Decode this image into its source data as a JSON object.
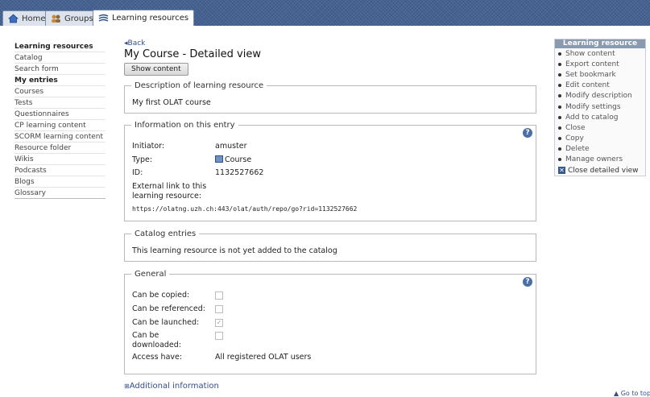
{
  "tabs": [
    {
      "label": "Home",
      "icon": "home-icon"
    },
    {
      "label": "Groups",
      "icon": "groups-icon"
    },
    {
      "label": "Learning resources",
      "icon": "learning-resources-icon",
      "active": true
    }
  ],
  "sidebar": {
    "items": [
      {
        "label": "Learning resources",
        "bold": true
      },
      {
        "label": "Catalog"
      },
      {
        "label": "Search form"
      },
      {
        "label": "My entries",
        "bold": true
      },
      {
        "label": "Courses"
      },
      {
        "label": "Tests"
      },
      {
        "label": "Questionnaires"
      },
      {
        "label": "CP learning content"
      },
      {
        "label": "SCORM learning content"
      },
      {
        "label": "Resource folder"
      },
      {
        "label": "Wikis"
      },
      {
        "label": "Podcasts"
      },
      {
        "label": "Blogs"
      },
      {
        "label": "Glossary"
      }
    ]
  },
  "main": {
    "back_label": "Back",
    "title": "My Course - Detailed view",
    "show_content_label": "Show content",
    "description": {
      "legend": "Description of learning resource",
      "text": "My first OLAT course"
    },
    "information": {
      "legend": "Information on this entry",
      "initiator_label": "Initiator:",
      "initiator_value": "amuster",
      "type_label": "Type:",
      "type_value": "Course",
      "id_label": "ID:",
      "id_value": "1132527662",
      "external_label": "External link to this learning resource:",
      "external_url": "https://olatng.uzh.ch:443/olat/auth/repo/go?rid=1132527662"
    },
    "catalog": {
      "legend": "Catalog entries",
      "text": "This learning resource is not yet added to the catalog"
    },
    "general": {
      "legend": "General",
      "copied_label": "Can be copied:",
      "copied": false,
      "referenced_label": "Can be referenced:",
      "referenced": false,
      "launched_label": "Can be launched:",
      "launched": true,
      "downloaded_label": "Can be downloaded:",
      "downloaded": false,
      "access_label": "Access have:",
      "access_value": "All registered OLAT users"
    },
    "additional_info_label": "Additional information"
  },
  "actions": {
    "header": "Learning resource",
    "items": [
      "Show content",
      "Export content",
      "Set bookmark",
      "Edit content",
      "Modify description",
      "Modify settings",
      "Add to catalog",
      "Close",
      "Copy",
      "Delete",
      "Manage owners"
    ],
    "close_view_label": "Close detailed view"
  },
  "go_to_top_label": "Go to top",
  "colors": {
    "topbar": "#3d5a8a",
    "link": "#344e8a",
    "action_header": "#8a9ab0"
  }
}
